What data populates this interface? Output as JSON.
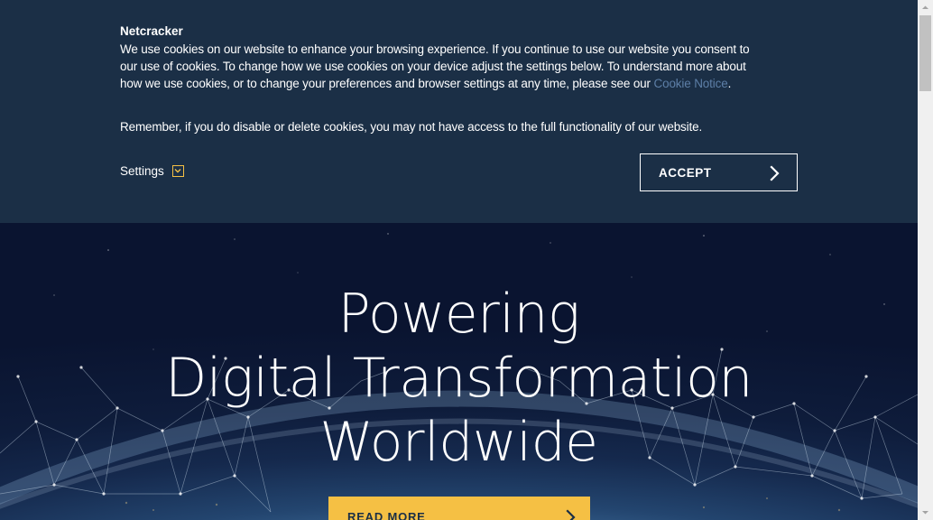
{
  "cookie_banner": {
    "brand": "Netcracker",
    "text_main": "We use cookies on our website to enhance your browsing experience.  If you continue to use our website you consent to our use of cookies. To change how we use cookies on your device adjust the settings below. To understand more about how we use cookies, or to change your preferences and browser settings at any time, please see our ",
    "link_text": "Cookie Notice",
    "text_end": ".",
    "remember": "Remember, if you do disable or delete cookies, you may not have access to the full functionality of our website.",
    "settings_label": "Settings",
    "settings_icon": "chevron-down-icon",
    "accept_label": "ACCEPT",
    "accept_icon": "chevron-right-icon"
  },
  "hero": {
    "title_lines": [
      "Powering",
      "Digital Transformation",
      "Worldwide"
    ],
    "read_more_label": "READ MORE",
    "read_more_icon": "chevron-right-icon"
  },
  "colors": {
    "banner_bg": "#1b2f46",
    "accent": "#f5c044",
    "link": "#5d7fa7"
  }
}
